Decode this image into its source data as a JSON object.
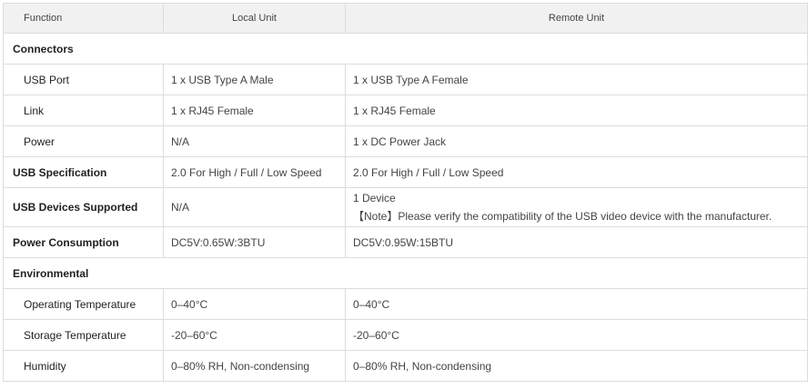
{
  "header": {
    "function": "Function",
    "local": "Local Unit",
    "remote": "Remote Unit"
  },
  "sections": {
    "connectors": "Connectors",
    "environmental": "Environmental"
  },
  "rows": {
    "usb_port": {
      "label": "USB Port",
      "local": "1 x USB Type A Male",
      "remote": "1 x USB Type A Female"
    },
    "link": {
      "label": "Link",
      "local": "1 x RJ45 Female",
      "remote": "1 x RJ45 Female"
    },
    "power": {
      "label": "Power",
      "local": "N/A",
      "remote": "1 x DC Power Jack"
    },
    "usb_spec": {
      "label": "USB Specification",
      "local": "2.0 For High / Full / Low Speed",
      "remote": "2.0 For High / Full / Low Speed"
    },
    "usb_devices": {
      "label": "USB Devices Supported",
      "local": "N/A",
      "remote": "1 Device",
      "remote_note": "【Note】Please verify the compatibility of the USB video device with the manufacturer."
    },
    "power_consumption": {
      "label": "Power Consumption",
      "local": "DC5V:0.65W:3BTU",
      "remote": "DC5V:0.95W:15BTU"
    },
    "operating_temp": {
      "label": "Operating Temperature",
      "local": "0–40°C",
      "remote": "0–40°C"
    },
    "storage_temp": {
      "label": "Storage Temperature",
      "local": "-20–60°C",
      "remote": "-20–60°C"
    },
    "humidity": {
      "label": "Humidity",
      "local": "0–80% RH, Non-condensing",
      "remote": "0–80% RH, Non-condensing"
    }
  }
}
